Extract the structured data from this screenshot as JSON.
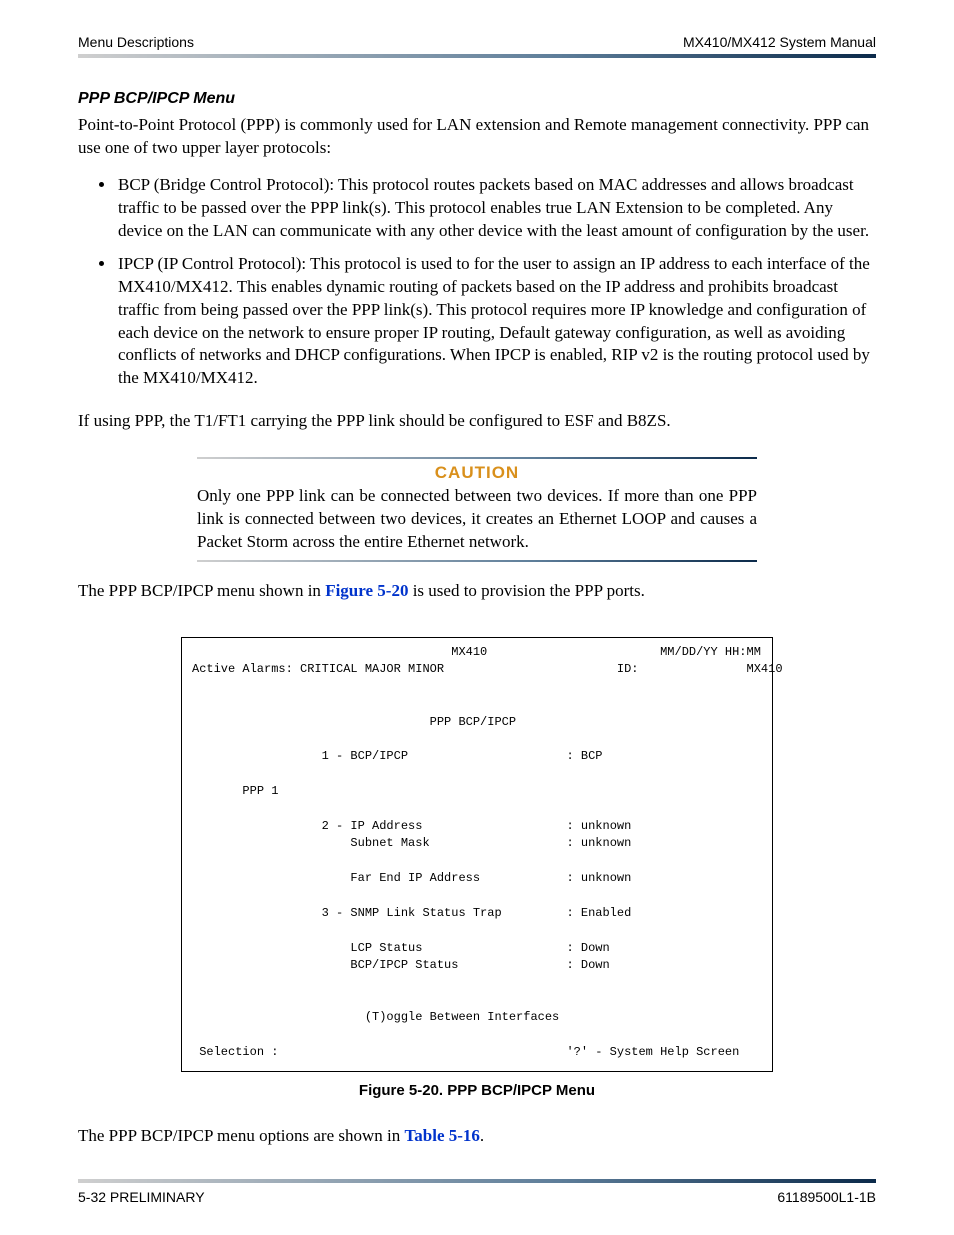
{
  "header": {
    "left": "Menu Descriptions",
    "right": "MX410/MX412 System Manual"
  },
  "section": {
    "heading": "PPP BCP/IPCP Menu",
    "intro": "Point-to-Point Protocol (PPP) is commonly used for LAN extension and Remote management connectivity. PPP can use one of two upper layer protocols:",
    "bullets": [
      "BCP (Bridge Control Protocol): This protocol routes packets based on MAC addresses and allows broadcast traffic to be passed over the PPP link(s). This protocol enables true LAN Extension to be completed. Any device on the LAN can communicate with any other device with the least amount of configuration by the user.",
      "IPCP (IP Control Protocol): This protocol is used to for the user to assign an IP address to each interface of the MX410/MX412. This enables dynamic routing of packets based on the IP address and prohibits broadcast traffic from being passed over the PPP link(s). This protocol requires more IP knowledge and configuration of each device on the network to ensure proper IP routing, Default gateway configuration, as well as avoiding conflicts of networks and DHCP configurations. When IPCP is enabled, RIP v2 is the routing protocol used by the MX410/MX412."
    ],
    "after_bullets": "If using PPP, the T1/FT1 carrying the PPP link should be configured to ESF and B8ZS."
  },
  "caution": {
    "title": "CAUTION",
    "text": "Only one PPP link can be connected between two devices. If more than one PPP link is connected between two devices, it creates an Ethernet LOOP and causes a Packet Storm across the entire Ethernet network."
  },
  "ref_line": {
    "before": "The PPP BCP/IPCP menu shown in ",
    "link": "Figure 5-20",
    "after": " is used to provision the PPP ports."
  },
  "terminal": {
    "title_center": "MX410",
    "datetime": "MM/DD/YY HH:MM",
    "alarms_label": "Active Alarms: CRITICAL MAJOR MINOR",
    "id_label": "ID:",
    "id_value": "MX410",
    "screen_title": "PPP BCP/IPCP",
    "opt1_label": "1 - BCP/IPCP",
    "opt1_value": ": BCP",
    "ppp_header": "PPP 1",
    "opt2_label": "2 - IP Address",
    "opt2_value": ": unknown",
    "subnet_label": "    Subnet Mask",
    "subnet_value": ": unknown",
    "farend_label": "    Far End IP Address",
    "farend_value": ": unknown",
    "opt3_label": "3 - SNMP Link Status Trap",
    "opt3_value": ": Enabled",
    "lcp_label": "    LCP Status",
    "lcp_value": ": Down",
    "bcpipcp_label": "    BCP/IPCP Status",
    "bcpipcp_value": ": Down",
    "toggle": "(T)oggle Between Interfaces",
    "selection_label": "Selection :",
    "help_text": "'?' - System Help Screen"
  },
  "figure_caption": "Figure 5-20.  PPP BCP/IPCP Menu",
  "ref_line2": {
    "before": "The PPP BCP/IPCP menu options are shown in ",
    "link": "Table 5-16",
    "after": "."
  },
  "footer": {
    "left": "5-32   PRELIMINARY",
    "right": "61189500L1-1B"
  }
}
